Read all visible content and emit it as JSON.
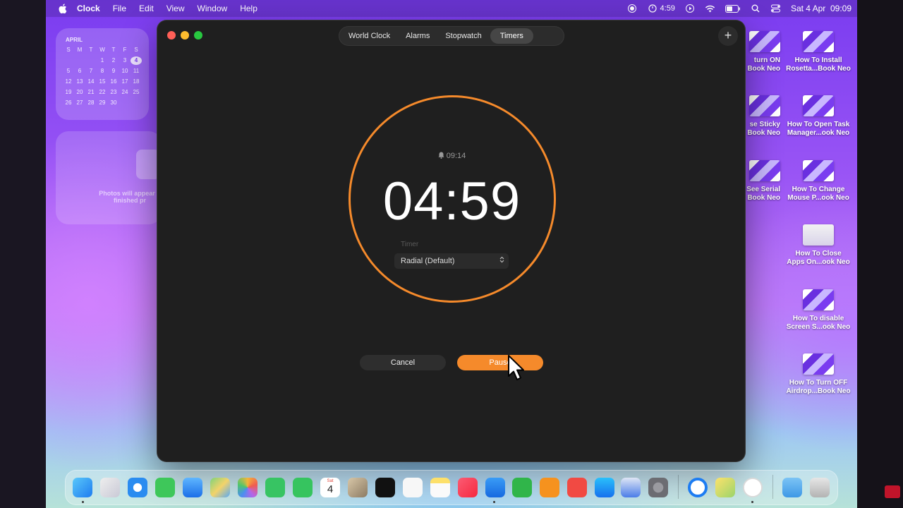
{
  "menubar": {
    "app_name": "Clock",
    "menus": [
      "File",
      "Edit",
      "View",
      "Window",
      "Help"
    ],
    "timer_status": "4:59",
    "date_time": "Sat 4 Apr  09:09"
  },
  "calendar_widget": {
    "month": "APRIL",
    "weekdays": [
      "S",
      "M",
      "T",
      "W",
      "T",
      "F",
      "S"
    ],
    "days": [
      "",
      "",
      "",
      "1",
      "2",
      "3",
      "4",
      "5",
      "6",
      "7",
      "8",
      "9",
      "10",
      "11",
      "12",
      "13",
      "14",
      "15",
      "16",
      "17",
      "18",
      "19",
      "20",
      "21",
      "22",
      "23",
      "24",
      "25",
      "26",
      "27",
      "28",
      "29",
      "30",
      "",
      ""
    ],
    "today": "4"
  },
  "photos_widget": {
    "text_line1": "Photos will appear h",
    "text_line2": "finished pr"
  },
  "desktop_icons": [
    {
      "line1": "How To Install",
      "line2": "Rosetta...Book Neo"
    },
    {
      "line1": "How To Open Task",
      "line2": "Manager...ook Neo"
    },
    {
      "line1": "How To Change",
      "line2": "Mouse P...ook Neo"
    },
    {
      "line1": "How To Close",
      "line2": "Apps On...ook Neo"
    },
    {
      "line1": "How To disable",
      "line2": "Screen S...ook Neo"
    },
    {
      "line1": "How To Turn OFF",
      "line2": "Airdrop...Book Neo"
    }
  ],
  "desktop_icons_partial": [
    {
      "line1": "turn ON",
      "line2": "Book Neo"
    },
    {
      "line1": "se Sticky",
      "line2": "Book Neo"
    },
    {
      "line1": "See Serial",
      "line2": "Book Neo"
    }
  ],
  "window": {
    "tabs": [
      "World Clock",
      "Alarms",
      "Stopwatch",
      "Timers"
    ],
    "active_tab": "Timers",
    "add_label": "+",
    "alarm_time": "09:14",
    "remaining": "04:59",
    "timer_label": "Timer",
    "style_value": "Radial (Default)",
    "cancel_label": "Cancel",
    "pause_label": "Pause",
    "accent": "#f58a2b"
  },
  "dock": {
    "calendar_day_label": "Sat",
    "calendar_day": "4"
  }
}
